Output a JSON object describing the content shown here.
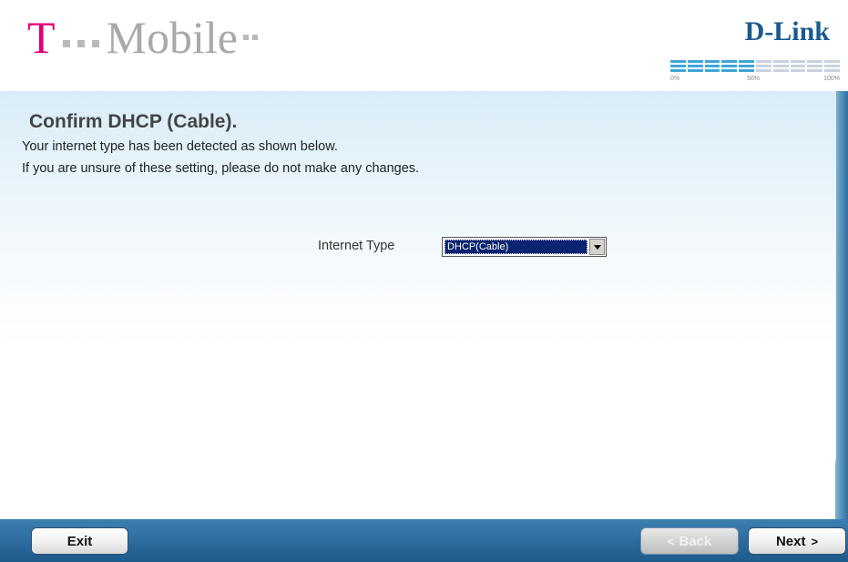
{
  "header": {
    "tmobile_logo_text": "Mobile",
    "tmobile_t": "T",
    "dlink_logo_text": "D-Link",
    "progress": {
      "label_start": "0%",
      "label_mid": "50%",
      "label_end": "100%",
      "fraction": 0.5
    }
  },
  "main": {
    "title": "Confirm DHCP (Cable).",
    "desc_line1": "Your internet type has been detected as shown below.",
    "desc_line2": "If you are unsure of these setting, please do not make any changes.",
    "internet_type_label": "Internet Type",
    "internet_type_value": "DHCP(Cable)"
  },
  "footer": {
    "exit_label": "Exit",
    "back_label": "Back",
    "next_label": "Next"
  },
  "colors": {
    "brand_magenta": "#e20074",
    "dlink_blue": "#1a5a8c",
    "bar_blue": "#1e5a8c",
    "selection_navy": "#0a2470"
  }
}
